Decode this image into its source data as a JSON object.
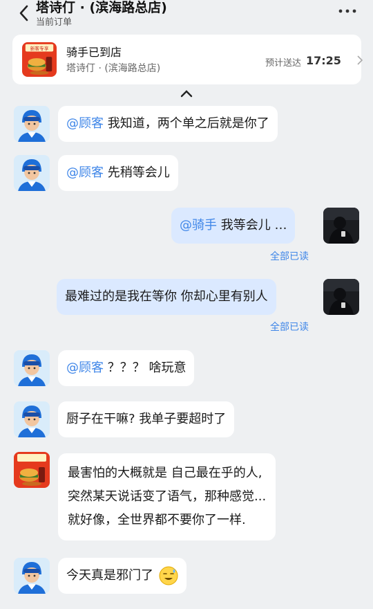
{
  "header": {
    "shop_name": "塔诗仃 · (滨海路总店)",
    "subtitle": "当前订单"
  },
  "order": {
    "status": "骑手已到店",
    "shop": "塔诗仃 · (滨海路总店)",
    "eta_label": "预计送达",
    "eta_time": "17:25",
    "thumb_badge": "新客专享"
  },
  "messages": [
    {
      "sender": "rider",
      "mention": "@顾客",
      "text": "我知道，两个单之后就是你了"
    },
    {
      "sender": "rider",
      "mention": "@顾客",
      "text": "先稍等会儿"
    },
    {
      "sender": "me",
      "mention": "@骑手",
      "text": "我等会儿 …",
      "status": "全部已读"
    },
    {
      "sender": "me",
      "text": "最难过的是我在等你 你却心里有别人",
      "status": "全部已读"
    },
    {
      "sender": "rider",
      "mention": "@顾客",
      "text": "？？？ 啥玩意"
    },
    {
      "sender": "rider",
      "text": "厨子在干嘛? 我单子要超时了"
    },
    {
      "sender": "shop",
      "lines": [
        "最害怕的大概就是 自己最在乎的人,",
        "突然某天说话变了语气，那种感觉...",
        "就好像，全世界都不要你了一样."
      ]
    },
    {
      "sender": "rider",
      "text": "今天真是邪门了",
      "emoji": "sweat-smile-emoji"
    }
  ],
  "colors": {
    "accent": "#3f86e8",
    "my_bubble": "#dbe9ff",
    "background": "#eef0f2"
  }
}
